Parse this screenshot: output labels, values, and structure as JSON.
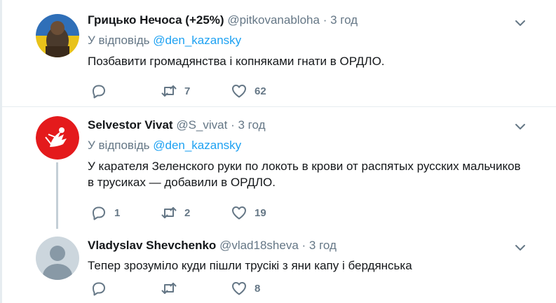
{
  "reply_prefix": "У відповідь",
  "tweets": [
    {
      "name": "Грицько Нечоса (+25%)",
      "handle": "@pitkovanabloha",
      "separator": "·",
      "time": "3 год",
      "reply_mention": "@den_kazansky",
      "text": "Позбавити громадянства і копняками гнати в ОРДЛО.",
      "replies": "",
      "retweets": "7",
      "likes": "62"
    },
    {
      "name": "Selvestor Vivat",
      "handle": "@S_vivat",
      "separator": "·",
      "time": "3 год",
      "reply_mention": "@den_kazansky",
      "text": "У карателя Зеленского руки по локоть в крови от распятых русских мальчиков в трусиках — добавили в ОРДЛО.",
      "replies": "1",
      "retweets": "2",
      "likes": "19"
    },
    {
      "name": "Vladyslav Shevchenko",
      "handle": "@vlad18sheva",
      "separator": "·",
      "time": "3 год",
      "text": "Тепер зрозуміло куди пішли трусікі з яни капу і бердянська",
      "replies": "",
      "retweets": "",
      "likes": "8"
    }
  ],
  "icons": {
    "reply": "reply-icon",
    "retweet": "retweet-icon",
    "like": "heart-icon",
    "menu": "chevron-down-icon"
  },
  "colors": {
    "text": "#14171a",
    "secondary": "#657786",
    "link": "#1da1f2",
    "divider": "#e6ecf0",
    "thread_line": "#c4cfd6",
    "avatar_red": "#e41a1c"
  }
}
